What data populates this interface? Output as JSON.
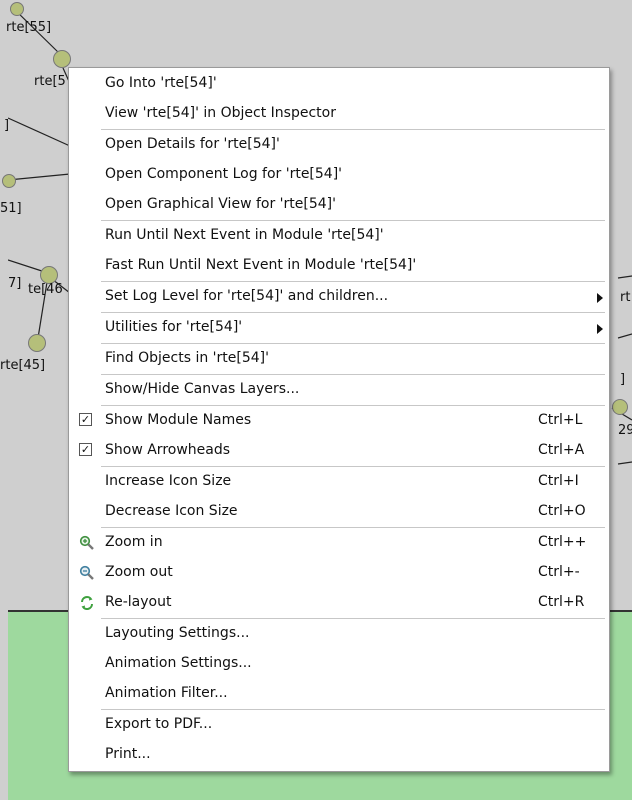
{
  "background": {
    "node_labels": [
      "rte[55]",
      "rte[5",
      "]",
      "51]",
      "7]",
      "te[46",
      "rte[45]",
      "rt",
      "]",
      "29]"
    ]
  },
  "menu": {
    "groups": [
      [
        {
          "label": "Go Into 'rte[54]'"
        },
        {
          "label": "View 'rte[54]' in Object Inspector"
        }
      ],
      [
        {
          "label": "Open Details for 'rte[54]'"
        },
        {
          "label": "Open Component Log for 'rte[54]'"
        },
        {
          "label": "Open Graphical View for 'rte[54]'"
        }
      ],
      [
        {
          "label": "Run Until Next Event in Module 'rte[54]'"
        },
        {
          "label": "Fast Run Until Next Event in Module 'rte[54]'"
        }
      ],
      [
        {
          "label": "Set Log Level for 'rte[54]' and children...",
          "submenu": true
        }
      ],
      [
        {
          "label": "Utilities for 'rte[54]'",
          "submenu": true
        }
      ],
      [
        {
          "label": "Find Objects in 'rte[54]'"
        }
      ],
      [
        {
          "label": "Show/Hide Canvas Layers..."
        }
      ],
      [
        {
          "label": "Show Module Names",
          "checked": true,
          "shortcut": "Ctrl+L"
        },
        {
          "label": "Show Arrowheads",
          "checked": true,
          "shortcut": "Ctrl+A"
        }
      ],
      [
        {
          "label": "Increase Icon Size",
          "shortcut": "Ctrl+I"
        },
        {
          "label": "Decrease Icon Size",
          "shortcut": "Ctrl+O"
        }
      ],
      [
        {
          "label": "Zoom in",
          "icon": "zoom-in-icon",
          "shortcut": "Ctrl++"
        },
        {
          "label": "Zoom out",
          "icon": "zoom-out-icon",
          "shortcut": "Ctrl+-"
        },
        {
          "label": "Re-layout",
          "icon": "relayout-icon",
          "shortcut": "Ctrl+R"
        }
      ],
      [
        {
          "label": "Layouting Settings..."
        },
        {
          "label": "Animation Settings..."
        },
        {
          "label": "Animation Filter..."
        }
      ],
      [
        {
          "label": "Export to PDF..."
        },
        {
          "label": "Print..."
        }
      ]
    ]
  },
  "colors": {
    "node_fill": "#b5bf7a",
    "network_bg": "#cfcfcf",
    "green_bg": "#9ed99e",
    "check_mark": "#111111"
  }
}
